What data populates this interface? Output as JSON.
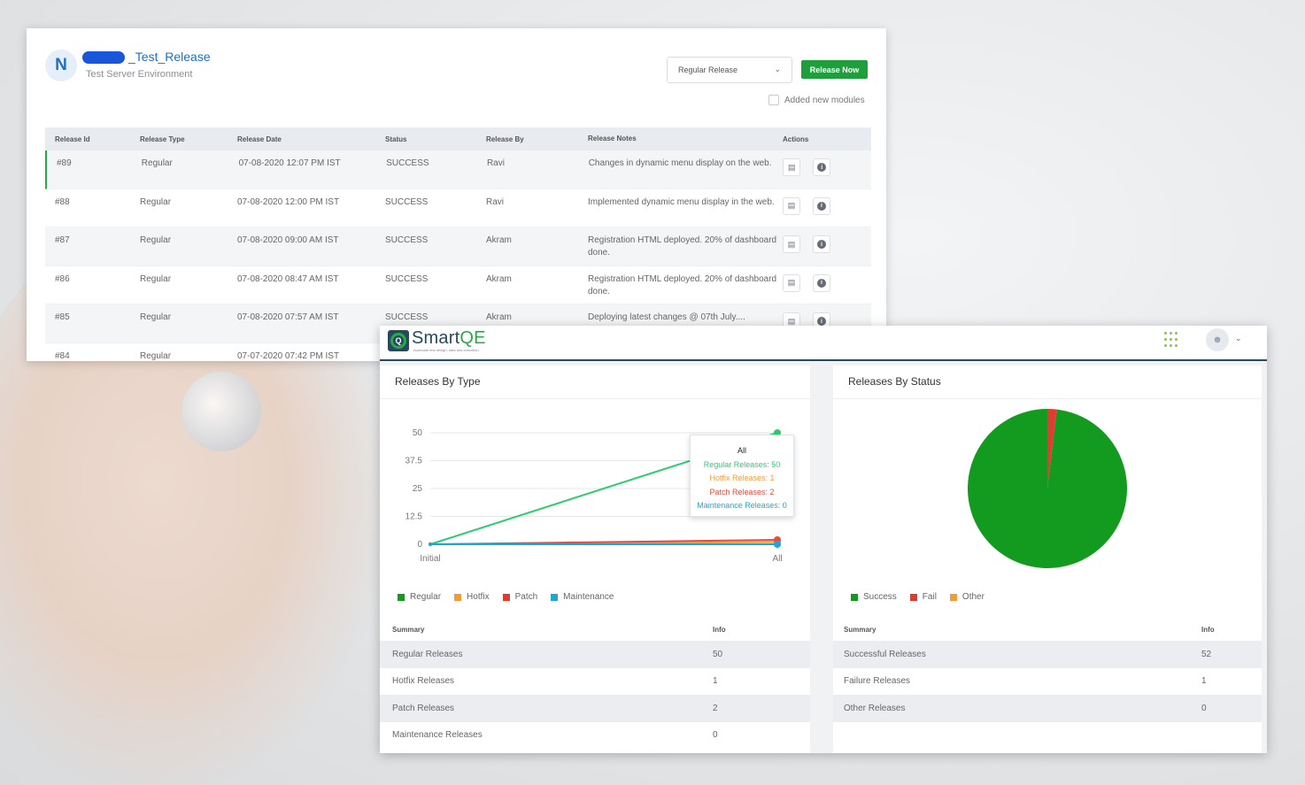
{
  "release": {
    "avatar_letter": "N",
    "title": "_Test_Release",
    "subtitle": "Test Server Environment",
    "select_value": "Regular Release",
    "release_button": "Release Now",
    "checkbox_label": "Added new modules",
    "columns": [
      "Release Id",
      "Release Type",
      "Release Date",
      "Status",
      "Release By",
      "Release Notes",
      "Actions"
    ],
    "rows": [
      {
        "id": "#89",
        "type": "Regular",
        "date": "07-08-2020 12:07 PM IST",
        "status": "SUCCESS",
        "by": "Ravi",
        "notes": "Changes in dynamic menu display on the web."
      },
      {
        "id": "#88",
        "type": "Regular",
        "date": "07-08-2020 12:00 PM IST",
        "status": "SUCCESS",
        "by": "Ravi",
        "notes": "Implemented dynamic menu display in the web."
      },
      {
        "id": "#87",
        "type": "Regular",
        "date": "07-08-2020 09:00 AM IST",
        "status": "SUCCESS",
        "by": "Akram",
        "notes": "Registration HTML deployed. 20% of dashboard done."
      },
      {
        "id": "#86",
        "type": "Regular",
        "date": "07-08-2020 08:47 AM IST",
        "status": "SUCCESS",
        "by": "Akram",
        "notes": "Registration HTML deployed. 20% of dashboard done."
      },
      {
        "id": "#85",
        "type": "Regular",
        "date": "07-08-2020 07:57 AM IST",
        "status": "SUCCESS",
        "by": "Akram",
        "notes": "Deploying latest changes @ 07th July...."
      },
      {
        "id": "#84",
        "type": "Regular",
        "date": "07-07-2020 07:42 PM IST",
        "status": "",
        "by": "",
        "notes": ""
      }
    ]
  },
  "dashboard": {
    "logo_main": "Smart",
    "logo_accent": "QE",
    "logo_tagline": "Automate test design, data and execution",
    "type_panel": {
      "title": "Releases By Type",
      "legend": [
        "Regular",
        "Hotfix",
        "Patch",
        "Maintenance"
      ],
      "tooltip": {
        "title": "All",
        "lines": [
          "Regular Releases: 50",
          "Hotfix Releases: 1",
          "Patch Releases: 2",
          "Maintenance Releases: 0"
        ]
      },
      "summary_header": [
        "Summary",
        "Info"
      ],
      "summary": [
        {
          "label": "Regular Releases",
          "value": "50"
        },
        {
          "label": "Hotfix Releases",
          "value": "1"
        },
        {
          "label": "Patch Releases",
          "value": "2"
        },
        {
          "label": "Maintenance Releases",
          "value": "0"
        }
      ]
    },
    "status_panel": {
      "title": "Releases By Status",
      "legend": [
        "Success",
        "Fail",
        "Other"
      ],
      "summary_header": [
        "Summary",
        "Info"
      ],
      "summary": [
        {
          "label": "Successful Releases",
          "value": "52"
        },
        {
          "label": "Failure Releases",
          "value": "1"
        },
        {
          "label": "Other Releases",
          "value": "0"
        }
      ]
    }
  },
  "colors": {
    "regular": "#2ecc71",
    "hotfix": "#f39c35",
    "patch": "#e74c3c",
    "maintenance": "#1ea7d6",
    "success": "#129b1e",
    "fail": "#e03c31",
    "other": "#f39c35"
  },
  "chart_data": [
    {
      "type": "line",
      "x": [
        "Initial",
        "All"
      ],
      "series": [
        {
          "name": "Regular",
          "values": [
            0,
            50
          ]
        },
        {
          "name": "Hotfix",
          "values": [
            0,
            1
          ]
        },
        {
          "name": "Patch",
          "values": [
            0,
            2
          ]
        },
        {
          "name": "Maintenance",
          "values": [
            0,
            0
          ]
        }
      ],
      "yticks": [
        "0",
        "12.5",
        "25",
        "37.5",
        "50"
      ],
      "ylim": [
        0,
        50
      ],
      "grid": true,
      "legend_position": "bottom-left"
    },
    {
      "type": "pie",
      "categories": [
        "Success",
        "Fail",
        "Other"
      ],
      "values": [
        52,
        1,
        0
      ],
      "legend_position": "bottom-left"
    }
  ]
}
